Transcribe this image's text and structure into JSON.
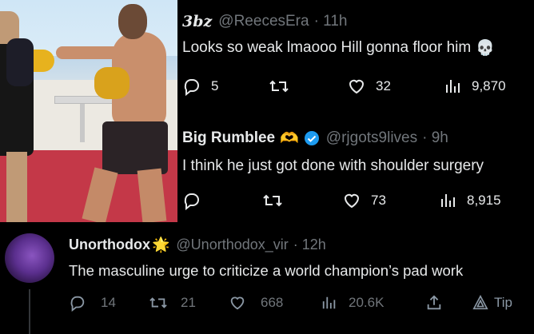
{
  "tweets": [
    {
      "name": "3bz",
      "handle": "@ReecesEra",
      "time": "· 11h",
      "text": "Looks so weak lmaooo Hill gonna floor him",
      "emoji": "💀",
      "replies": "5",
      "retweets": "",
      "likes": "32",
      "views": "9,870"
    },
    {
      "name": "Big Rumblee",
      "name_emoji": "🫶",
      "handle": "@rjgots9lives",
      "time": "· 9h",
      "text": "I think he just got done with shoulder surgery",
      "replies": "",
      "retweets": "",
      "likes": "73",
      "views": "8,915"
    },
    {
      "name": "Unorthodox",
      "name_emoji": "🌟",
      "handle": "@Unorthodox_vir",
      "time": "· 12h",
      "text": "The masculine urge to criticize a world champion’s pad work",
      "replies": "14",
      "retweets": "21",
      "likes": "668",
      "views": "20.6K",
      "tip": "Tip"
    }
  ],
  "icons": {
    "reply": "reply-icon",
    "retweet": "retweet-icon",
    "like": "heart-icon",
    "views": "views-icon",
    "share": "share-icon",
    "tip": "tip-icon"
  },
  "colors": {
    "background": "#000000",
    "text": "#e7e9ea",
    "muted": "#71767b",
    "verified": "#1d9bf0"
  }
}
